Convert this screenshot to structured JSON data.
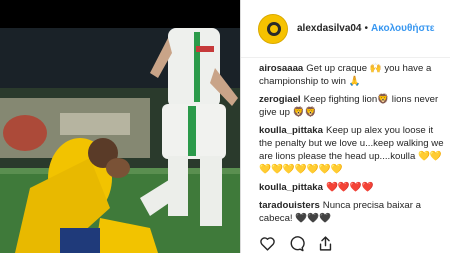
{
  "post": {
    "username": "alexdasilva04",
    "separator": "•",
    "follow_label": "Ακολουθήστε"
  },
  "comments": [
    {
      "user": "airosaaaa",
      "text": "Get up craque 🙌 you have a championship to win 🙏"
    },
    {
      "user": "zerogiael",
      "text": "Keep fighting lion🦁 lions never give up 🦁🦁"
    },
    {
      "user": "koulla_pittaka",
      "text": "Keep up alex you loose it the penalty but we love u...keep walking we are lions please the head up....koulla 💛💛💛💛💛💛💛💛💛"
    },
    {
      "user": "koulla_pittaka",
      "text": "❤️❤️❤️❤️"
    },
    {
      "user": "taradouisters",
      "text": "Nunca precisa baixar a cabeca! 🖤🖤🖤"
    }
  ],
  "icons": {
    "like": "heart-outline-icon",
    "comment": "comment-bubble-icon",
    "share": "share-icon"
  },
  "colors": {
    "link": "#3897f0",
    "text": "#262626",
    "jersey_yellow": "#f2c300",
    "avatar_bg": "#f6c200"
  }
}
